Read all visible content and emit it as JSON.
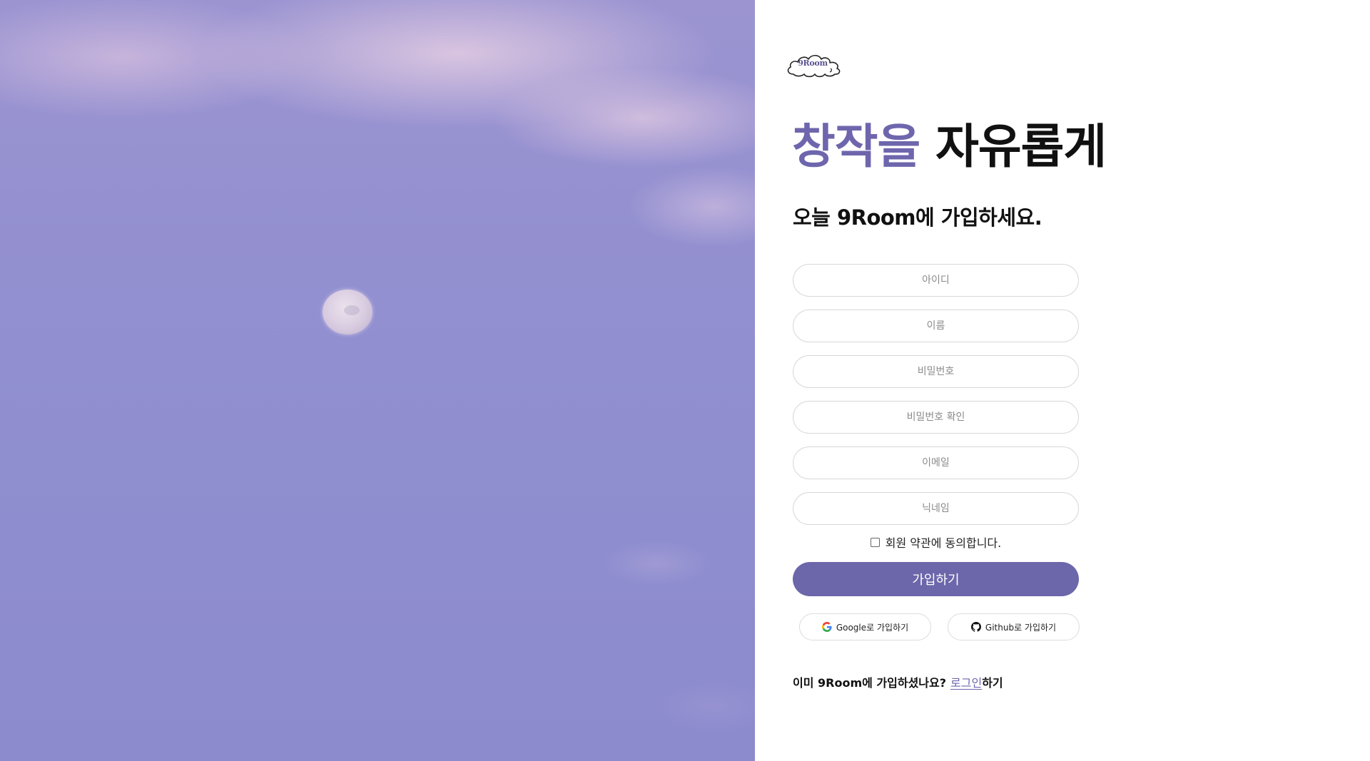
{
  "brand": {
    "logo_text": "9Room",
    "accent_color": "#6e66ad",
    "button_color": "#6c66aa"
  },
  "hero": {
    "headline_accent": "창작을",
    "headline_rest": "자유롭게",
    "subheading": "오늘 9Room에 가입하세요."
  },
  "form": {
    "fields": [
      {
        "placeholder": "아이디",
        "value": ""
      },
      {
        "placeholder": "이름",
        "value": ""
      },
      {
        "placeholder": "비밀번호",
        "value": ""
      },
      {
        "placeholder": "비밀번호 확인",
        "value": ""
      },
      {
        "placeholder": "이메일",
        "value": ""
      },
      {
        "placeholder": "닉네임",
        "value": ""
      }
    ],
    "terms_label": "회원 약관에 동의합니다.",
    "terms_checked": false,
    "submit_label": "가입하기"
  },
  "social": {
    "google_label": "Google로 가입하기",
    "google_icon": "google-icon",
    "github_label": "Github로 가입하기",
    "github_icon": "github-icon"
  },
  "footer": {
    "prompt": "이미 9Room에 가입하셨나요?",
    "login_link": "로그인",
    "suffix": "하기"
  }
}
